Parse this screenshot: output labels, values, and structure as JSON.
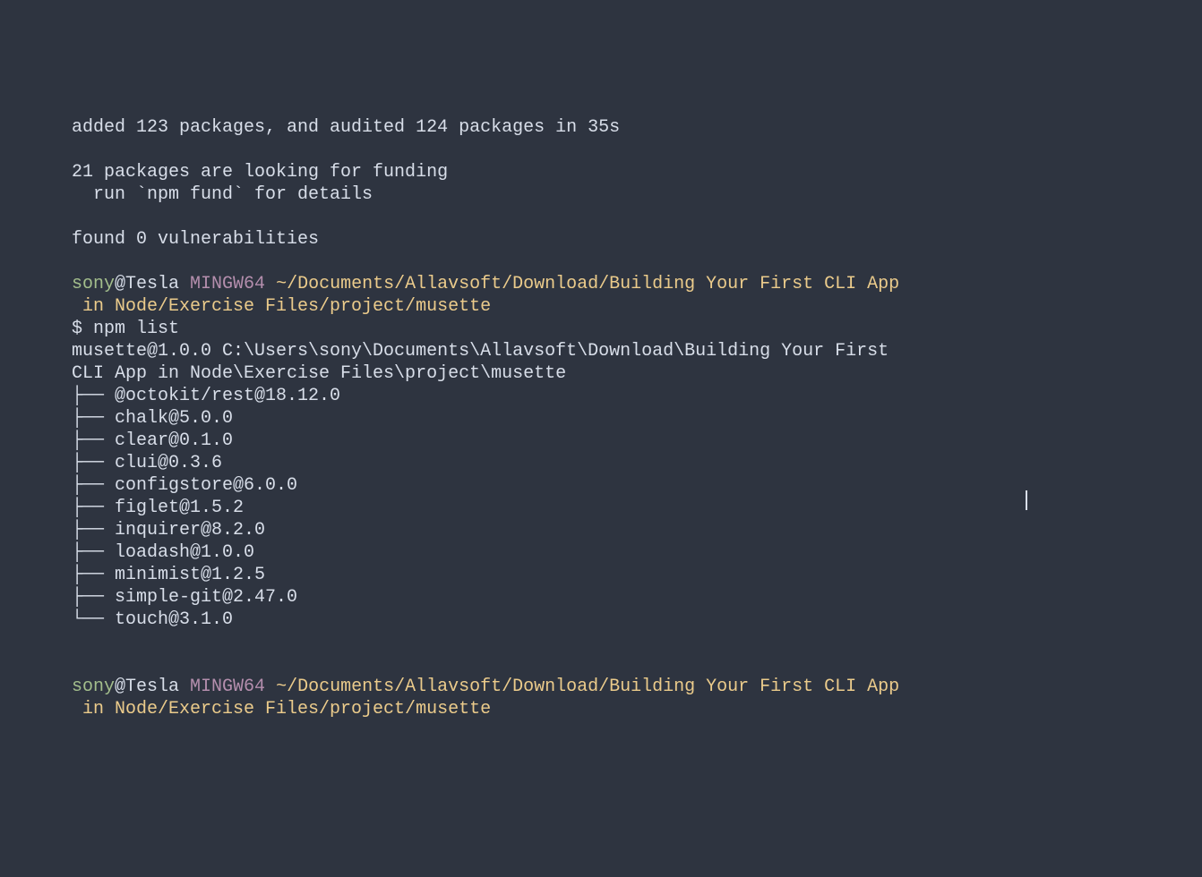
{
  "output": {
    "line1": "added 123 packages, and audited 124 packages in 35s",
    "blank1": "",
    "line2": "21 packages are looking for funding",
    "line3": "  run `npm fund` for details",
    "blank2": "",
    "line4": "found 0 vulnerabilities",
    "blank3": ""
  },
  "prompt1": {
    "user": "sony",
    "at": "@",
    "host": "Tesla",
    "env": " MINGW64",
    "path_line1": " ~/Documents/Allavsoft/Download/Building Your First CLI App",
    "path_line2": " in Node/Exercise Files/project/musette",
    "prompt_char": "$ ",
    "command": "npm list"
  },
  "npm_list": {
    "header_line1": "musette@1.0.0 C:\\Users\\sony\\Documents\\Allavsoft\\Download\\Building Your First ",
    "header_line2": "CLI App in Node\\Exercise Files\\project\\musette",
    "deps": [
      "├── @octokit/rest@18.12.0",
      "├── chalk@5.0.0",
      "├── clear@0.1.0",
      "├── clui@0.3.6",
      "├── configstore@6.0.0",
      "├── figlet@1.5.2",
      "├── inquirer@8.2.0",
      "├── loadash@1.0.0",
      "├── minimist@1.2.5",
      "├── simple-git@2.47.0",
      "└── touch@3.1.0"
    ]
  },
  "prompt2": {
    "user": "sony",
    "at": "@",
    "host": "Tesla",
    "env": " MINGW64",
    "path_line1": " ~/Documents/Allavsoft/Download/Building Your First CLI App",
    "path_line2": " in Node/Exercise Files/project/musette"
  }
}
